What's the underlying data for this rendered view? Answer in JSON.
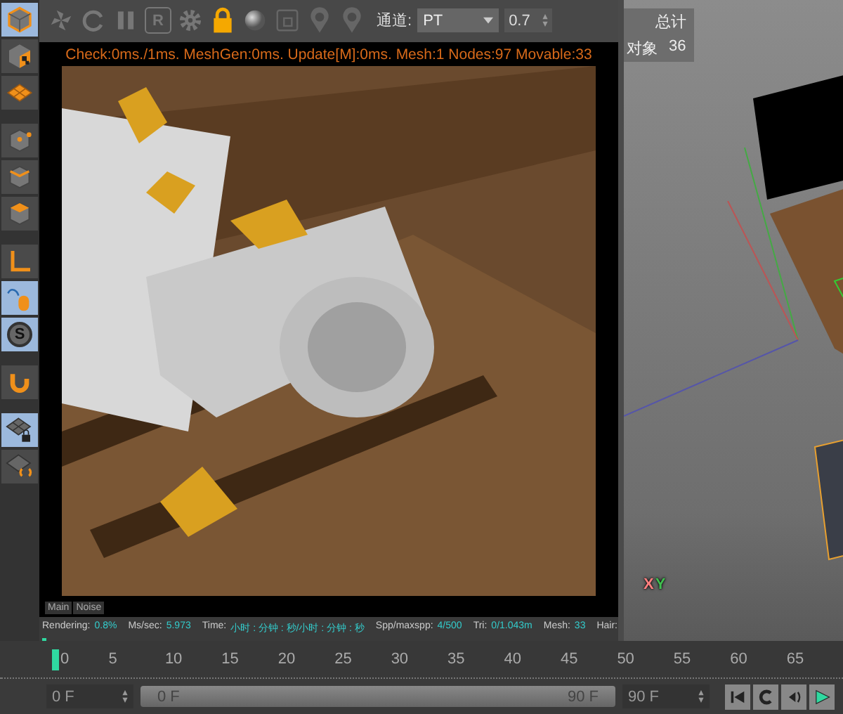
{
  "left_tools": [
    {
      "kind": "cube",
      "selected": true
    },
    {
      "kind": "checker-cube",
      "selected": false
    },
    {
      "kind": "grid-plane",
      "selected": false
    },
    {
      "kind": "cube-points",
      "selected": false
    },
    {
      "kind": "cube-edges",
      "selected": false
    },
    {
      "kind": "cube-polygons",
      "selected": false
    },
    {
      "kind": "axis",
      "selected": false
    },
    {
      "kind": "mouse",
      "selected": true
    },
    {
      "kind": "letter-circle",
      "glyph": "S",
      "selected": true
    },
    {
      "kind": "magnet",
      "selected": false
    },
    {
      "kind": "grid-lock",
      "selected": true
    },
    {
      "kind": "grid-refresh",
      "selected": false
    }
  ],
  "render_toolbar": {
    "tools": [
      {
        "kind": "pinwheel"
      },
      {
        "kind": "refresh"
      },
      {
        "kind": "pause"
      },
      {
        "kind": "letter-box",
        "glyph": "R"
      },
      {
        "kind": "settings"
      },
      {
        "kind": "lock"
      },
      {
        "kind": "sphere"
      },
      {
        "kind": "square"
      },
      {
        "kind": "pin"
      },
      {
        "kind": "pin"
      }
    ],
    "channel_label": "通道:",
    "channel": "PT",
    "value": "0.7"
  },
  "stats": "Check:0ms./1ms. MeshGen:0ms. Update[M]:0ms. Mesh:1 Nodes:97 Movable:33",
  "tabs": [
    "Main",
    "Noise"
  ],
  "status": [
    {
      "label": "Rendering:",
      "value": "0.8%"
    },
    {
      "label": "Ms/sec:",
      "value": "5.973"
    },
    {
      "label": "Time:",
      "value": "小时 : 分钟 : 秒/小时 : 分钟 : 秒"
    },
    {
      "label": "Spp/maxspp:",
      "value": "4/500"
    },
    {
      "label": "Tri:",
      "value": "0/1.043m"
    },
    {
      "label": "Mesh:",
      "value": "33"
    },
    {
      "label": "Hair:"
    }
  ],
  "progress": {
    "level": 0.008
  },
  "viewport": {
    "hud_header": "总计",
    "hud_rows": [
      {
        "label": "对象",
        "value": "36"
      }
    ],
    "axis_labels": [
      {
        "label": "X",
        "color": "#ff8080"
      },
      {
        "label": "Y",
        "color": "#40c050"
      }
    ]
  },
  "timeline": {
    "ticks": [
      {
        "label": "0",
        "selected": true
      },
      {
        "label": "5",
        "selected": false
      },
      {
        "label": "10",
        "selected": false
      },
      {
        "label": "15",
        "selected": false
      },
      {
        "label": "20",
        "selected": false
      },
      {
        "label": "25",
        "selected": false
      },
      {
        "label": "30",
        "selected": false
      },
      {
        "label": "35",
        "selected": false
      },
      {
        "label": "40",
        "selected": false
      },
      {
        "label": "45",
        "selected": false
      },
      {
        "label": "50",
        "selected": false
      },
      {
        "label": "55",
        "selected": false
      },
      {
        "label": "60",
        "selected": false
      },
      {
        "label": "65",
        "selected": false
      }
    ]
  },
  "range": {
    "level": 1,
    "start": "0 F",
    "slider_start": "0 F",
    "slider_end": "90 F",
    "end": "90 F"
  },
  "transport": [
    {
      "kind": "first"
    },
    {
      "kind": "loop"
    },
    {
      "kind": "step-back"
    },
    {
      "kind": "play"
    }
  ]
}
